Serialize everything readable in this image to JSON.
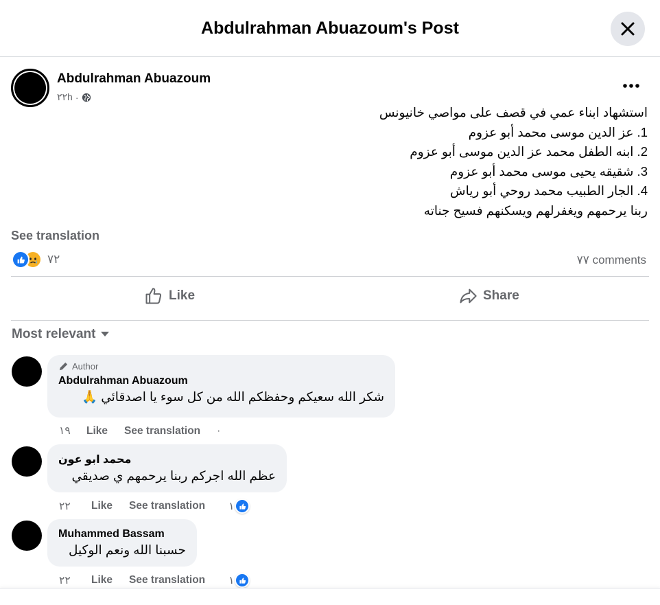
{
  "header": {
    "title": "Abdulrahman Abuazoum's Post"
  },
  "post": {
    "author": "Abdulrahman Abuazoum",
    "time": "٢٢h",
    "lines": [
      "استشهاد ابناء عمي في قصف على مواصي خانيونس",
      "1. عز الدين موسى محمد أبو عزوم",
      "2. ابنه الطفل محمد عز الدين موسى أبو عزوم",
      "3. شقيقه يحيى موسى محمد أبو عزوم",
      "4. الجار الطبيب محمد روحي أبو رياش",
      "ربنا يرحمهم ويغفرلهم ويسكنهم فسيح جناته"
    ],
    "see_translation": "See translation",
    "reaction_count": "٧٢",
    "comments_count": "٧٧ comments"
  },
  "actions": {
    "like": "Like",
    "share": "Share"
  },
  "sort": {
    "label": "Most relevant"
  },
  "comments": [
    {
      "badge": "Author",
      "name": "Abdulrahman Abuazoum",
      "text": "شكر الله سعيكم وحفظكم الله من كل سوء يا اصدقائي 🙏",
      "time": "١٩",
      "like": "Like",
      "translate": "See translation",
      "likes": ""
    },
    {
      "badge": "",
      "name": "محمد ابو عون",
      "text": "عظم الله اجركم ربنا يرحمهم ي صديقي",
      "time": "٢٢",
      "like": "Like",
      "translate": "See translation",
      "likes": "١"
    },
    {
      "badge": "",
      "name": "Muhammed Bassam",
      "text": "حسبنا الله ونعم الوكيل",
      "time": "٢٢",
      "like": "Like",
      "translate": "See translation",
      "likes": "١"
    }
  ],
  "colors": {
    "accent": "#1877f2",
    "muted": "#65676b",
    "bubble": "#f0f2f5",
    "sad": "#f7b125"
  },
  "icons": [
    "close-icon",
    "globe-icon",
    "more-icon",
    "like-reaction-icon",
    "sad-reaction-icon",
    "thumbs-up-icon",
    "share-icon",
    "caret-down-icon",
    "pencil-icon"
  ]
}
